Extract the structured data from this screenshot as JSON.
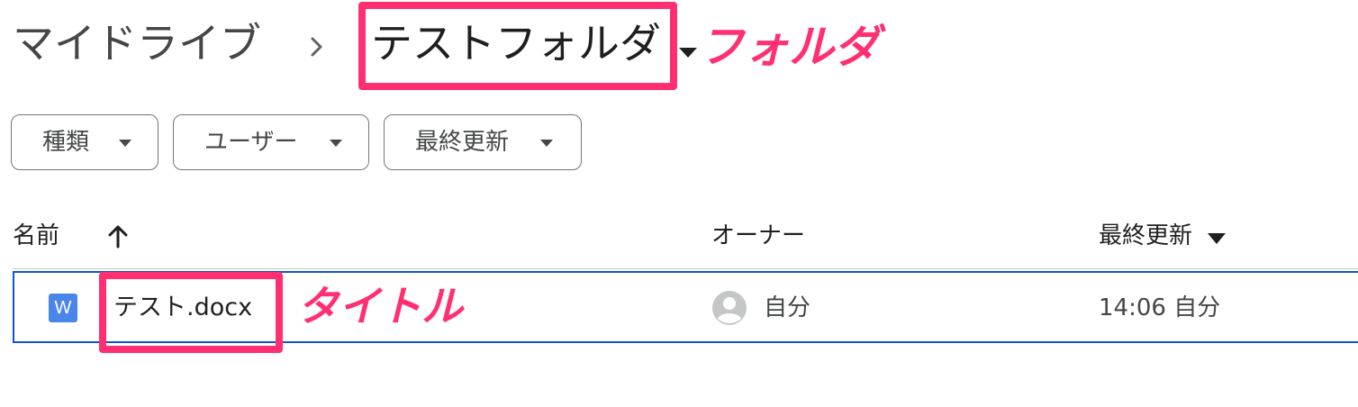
{
  "breadcrumb": {
    "root": "マイドライブ",
    "separator_icon": "chevron-right-icon",
    "current": "テストフォルダ",
    "current_dropdown_icon": "caret-down-icon"
  },
  "annotations": {
    "folder_label": "フォルダ",
    "title_label": "タイトル",
    "color": "#ff2f72"
  },
  "filters": [
    {
      "label": "種類",
      "icon": "caret-down-icon"
    },
    {
      "label": "ユーザー",
      "icon": "caret-down-icon"
    },
    {
      "label": "最終更新",
      "icon": "caret-down-icon"
    }
  ],
  "table": {
    "columns": {
      "name": "名前",
      "name_sort_icon": "arrow-up-icon",
      "owner": "オーナー",
      "updated": "最終更新",
      "updated_sort_icon": "caret-down-icon"
    },
    "rows": [
      {
        "file_icon": "word-icon",
        "file_icon_letter": "W",
        "name": "テスト.docx",
        "owner_icon": "account-circle-icon",
        "owner": "自分",
        "updated": "14:06 自分",
        "selected": true
      }
    ]
  },
  "colors": {
    "accent": "#0b57d0",
    "highlight": "#ff2f72",
    "word_icon": "#4a86e8"
  }
}
